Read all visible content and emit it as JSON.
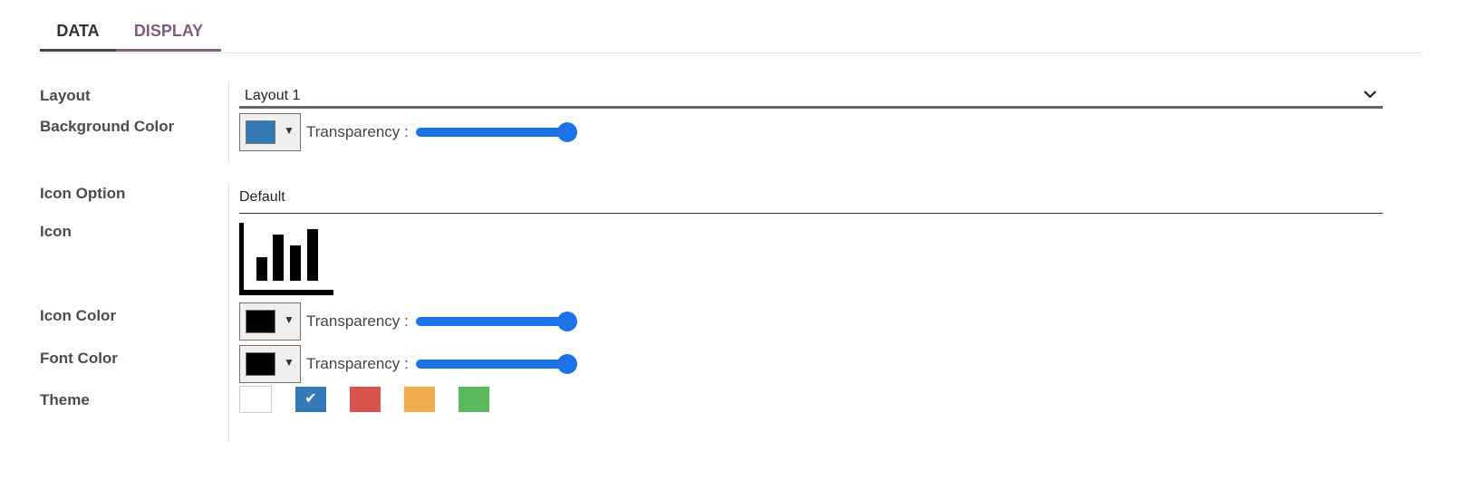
{
  "tabs": {
    "data": "DATA",
    "display": "DISPLAY"
  },
  "layout": {
    "label": "Layout",
    "value": "Layout 1"
  },
  "background_color": {
    "label": "Background Color",
    "color": "#337ab7",
    "transparency_label": "Transparency :",
    "transparency_value": 1.0
  },
  "icon_option": {
    "label": "Icon Option",
    "value": "Default"
  },
  "icon": {
    "label": "Icon",
    "name": "bar-chart-icon"
  },
  "icon_color": {
    "label": "Icon Color",
    "color": "#000000",
    "transparency_label": "Transparency :",
    "transparency_value": 1.0
  },
  "font_color": {
    "label": "Font Color",
    "color": "#000000",
    "transparency_label": "Transparency :",
    "transparency_value": 1.0
  },
  "theme": {
    "label": "Theme",
    "options": [
      {
        "color": "#ffffff",
        "selected": false
      },
      {
        "color": "#337ab7",
        "selected": true,
        "mark": "✔"
      },
      {
        "color": "#d9534f",
        "selected": false
      },
      {
        "color": "#f0ad4e",
        "selected": false
      },
      {
        "color": "#5cb85c",
        "selected": false
      }
    ]
  }
}
